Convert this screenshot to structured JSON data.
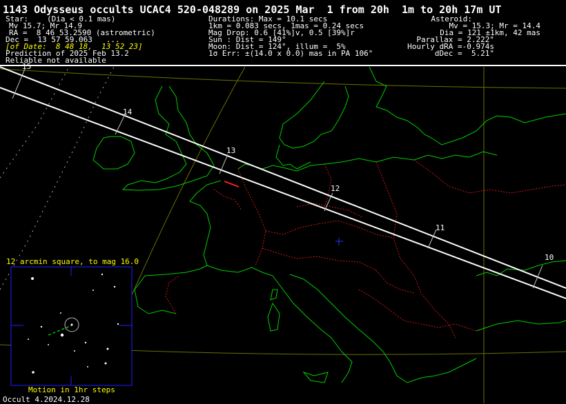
{
  "header": {
    "title": "1143 Odysseus occults UCAC4 520-048289 on 2025 Mar  1 from 20h  1m to 20h 17m UT",
    "star": {
      "heading": "Star:",
      "dia": "(Dia < 0.1 mas)",
      "mags": "Mv 15.7; Mr 14.9",
      "ra": "RA =  8 46 53.2590 (astrometric)",
      "dec": "Dec =  13 57 59.063   ...",
      "of_date": "[of Date:  8 48 18,  13 52 23]",
      "prediction": "Prediction of 2025 Feb 13.2",
      "reliability": "Reliable not available"
    },
    "event": {
      "durations": "Durations: Max = 10.1 secs",
      "km": "1km = 0.083 secs, 1mas = 0.24 secs",
      "mag_drop": "Mag Drop: 0.6 [41%]v, 0.5 [39%]r",
      "sun": "Sun : Dist = 149°",
      "moon": "Moon: Dist = 124°, illum =  5%",
      "error": "1σ Err: ±(14.0 x 0.0) mas in PA 106°"
    },
    "asteroid": {
      "heading": "Asteroid:",
      "mags": "Mv = 15.3; Mr = 14.4",
      "dia": "Dia = 121 ±1km, 42 mas",
      "parallax": "Parallax = 2.222\"",
      "dra": "Hourly dRA =-0.974s",
      "ddec": "dDec =  5.21\""
    }
  },
  "map": {
    "colors": {
      "coast": "#00ff00",
      "border": "#ff2020",
      "grid": "#808000",
      "path": "#ffffff",
      "centerline": "#ffffff",
      "observer": "#3030ff",
      "ticks": "#c0c0c0"
    },
    "time_ticks": [
      {
        "label": "15"
      },
      {
        "label": "14"
      },
      {
        "label": "13"
      },
      {
        "label": "12"
      },
      {
        "label": "11"
      },
      {
        "label": "10"
      }
    ]
  },
  "inset": {
    "title": "12 arcmin square, to mag 16.0",
    "footer": "Motion in 1hr steps",
    "color": "#ffff00",
    "frame_color": "#2020ff"
  },
  "version": "Occult 4.2024.12.28"
}
